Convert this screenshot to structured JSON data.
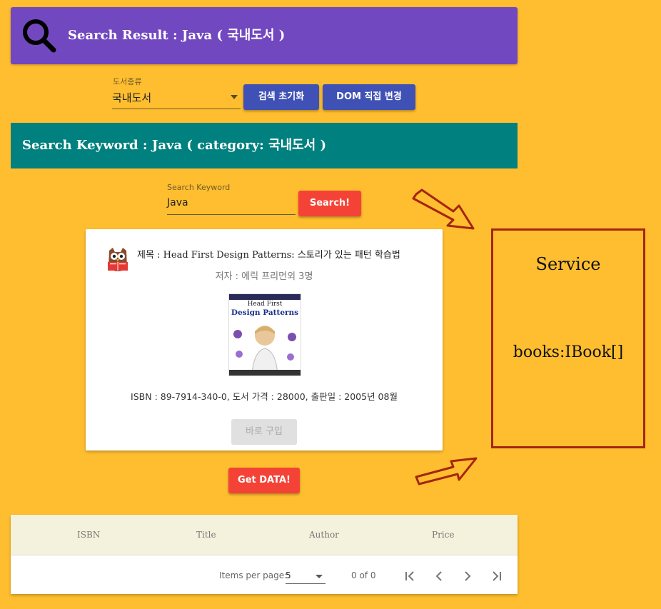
{
  "header": {
    "title": "Search Result : Java ( 국내도서 )",
    "icon": "search-icon"
  },
  "category": {
    "label": "도서종류",
    "value": "국내도서"
  },
  "buttons": {
    "reset": "검색 초기화",
    "dom": "DOM 직접 변경",
    "search": "Search!",
    "get_data": "Get DATA!",
    "buy": "바로 구입"
  },
  "keyword_bar": {
    "title": "Search Keyword : Java ( category: 국내도서 )"
  },
  "search": {
    "label": "Search Keyword",
    "value": "Java"
  },
  "book": {
    "title": "제목 : Head First Design Patterns: 스토리가 있는 패턴 학습법",
    "author": "저자 : 에릭 프리먼외 3명",
    "info": "ISBN : 89-7914-340-0, 도서 가격 : 28000, 출판일 : 2005년 08월",
    "cover_line1": "Head First",
    "cover_line2": "Design Patterns"
  },
  "table": {
    "columns": [
      "ISBN",
      "Title",
      "Author",
      "Price"
    ],
    "items_per_page_label": "Items per page:",
    "items_per_page_value": "5",
    "range": "0 of 0"
  },
  "service": {
    "title": "Service",
    "body": "books:IBook[]"
  },
  "colors": {
    "background": "#FFBE2F",
    "header": "#7248C0",
    "keyword_bar": "#00807E",
    "primary": "#3F51B5",
    "accent": "#F44336",
    "annotation": "#A5250F"
  }
}
